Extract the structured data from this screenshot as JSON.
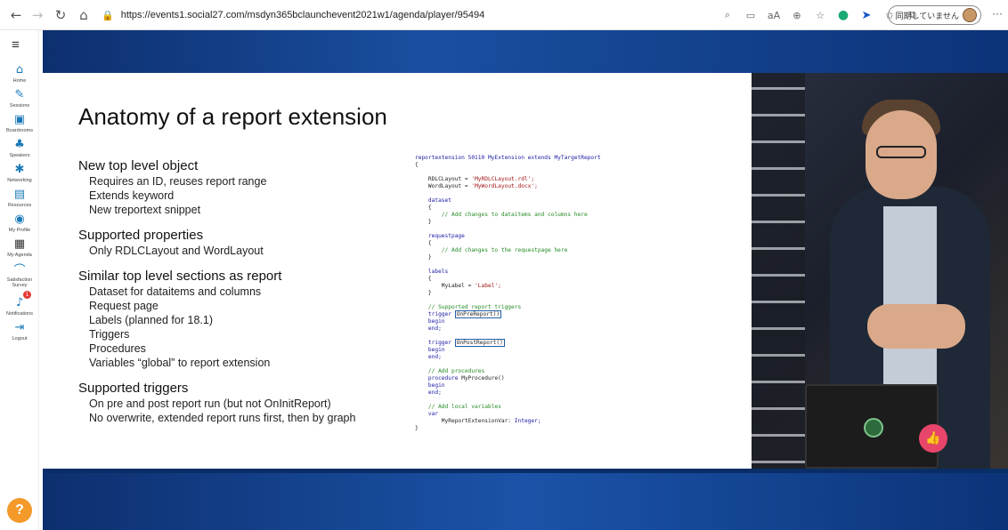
{
  "browser": {
    "url": "https://events1.social27.com/msdyn365bclaunchevent2021w1/agenda/player/95494",
    "sync_label": "同期していません",
    "more": "···"
  },
  "sidebar": {
    "items": [
      {
        "label": "Home",
        "icon": "home-icon"
      },
      {
        "label": "Sessions",
        "icon": "pencil-icon"
      },
      {
        "label": "Boardrooms",
        "icon": "boardroom-icon"
      },
      {
        "label": "Speakers",
        "icon": "speaker-icon"
      },
      {
        "label": "Networking",
        "icon": "network-icon"
      },
      {
        "label": "Resources",
        "icon": "resources-icon"
      },
      {
        "label": "My Profile",
        "icon": "profile-icon"
      },
      {
        "label": "My Agenda",
        "icon": "calendar-icon"
      },
      {
        "label": "Satisfaction Survey",
        "icon": "survey-icon"
      },
      {
        "label": "Notifications",
        "icon": "bell-icon",
        "badge": "1"
      },
      {
        "label": "Logout",
        "icon": "logout-icon"
      }
    ],
    "help": "?"
  },
  "slide": {
    "title": "Anatomy of a report extension",
    "sections": [
      {
        "heading": "New top level object",
        "items": [
          "Requires an ID, reuses report range",
          "Extends keyword",
          "New treportext snippet"
        ]
      },
      {
        "heading": "Supported properties",
        "items": [
          "Only RDLCLayout and WordLayout"
        ]
      },
      {
        "heading": "Similar top level sections as report",
        "items": [
          "Dataset for dataitems and columns",
          "Request page",
          "Labels (planned for 18.1)",
          "Triggers",
          "Procedures",
          "Variables “global” to report extension"
        ]
      },
      {
        "heading": "Supported triggers",
        "items": [
          "On pre and post report run (but not OnInitReport)",
          "No overwrite, extended report runs first, then by graph"
        ]
      }
    ],
    "code": {
      "l1": "reportextension 50110 MyExtension extends MyTargetReport",
      "l2": "{",
      "l3_a": "    RDLCLayout = ",
      "l3_b": "'MyRDLCLayout.rdl';",
      "l4_a": "    WordLayout = ",
      "l4_b": "'MyWordLayout.docx';",
      "dataset": "    dataset",
      "ob": "    {",
      "dataset_cm": "        // Add changes to dataitems and columns here",
      "cb": "    }",
      "requestpage": "    requestpage",
      "requestpage_cm": "        // Add changes to the requestpage here",
      "labels": "    labels",
      "mylabel_a": "        MyLabel = ",
      "mylabel_b": "'Label';",
      "triggers_cm": "    // Supported report triggers",
      "trigger": "    trigger ",
      "onpre": "OnPreReport()",
      "begin": "    begin",
      "end": "    end;",
      "onpost": "OnPostReport()",
      "proc_cm": "    // Add procedures",
      "procedure": "    procedure ",
      "myproc": "MyProcedure()",
      "vars_cm": "    // Add local variables",
      "var": "    var",
      "myvar_a": "        MyReportExtensionVar: ",
      "myvar_b": "Integer;",
      "close": "}"
    }
  },
  "like_icon": "thumbs-up-icon"
}
